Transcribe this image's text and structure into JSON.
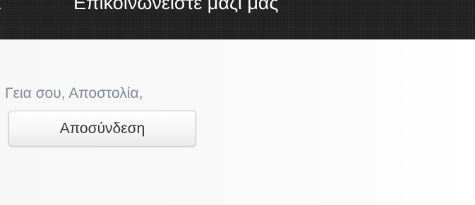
{
  "header": {
    "nav_items": [
      {
        "label": "a"
      },
      {
        "label": "Επικοινωνείστε μαζί μας"
      }
    ]
  },
  "user": {
    "greeting": "Γεια σου, Αποστολία,",
    "logout_label": "Αποσύνδεση"
  }
}
